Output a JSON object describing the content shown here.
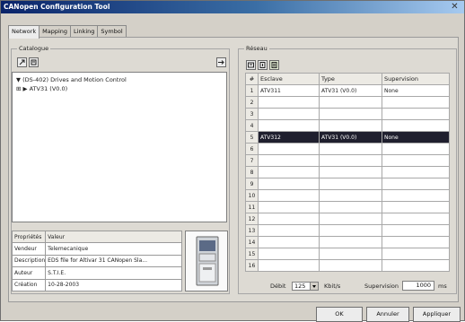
{
  "window": {
    "title": "CANopen Configuration Tool",
    "close_glyph": "✕"
  },
  "tabs": [
    "Network",
    "Mapping",
    "Linking",
    "Symbol"
  ],
  "catalogue": {
    "label": "Catalogue",
    "tree": [
      {
        "expander": "▼",
        "text": "(DS-402) Drives and Motion Control"
      },
      {
        "expander": "⊞  ▶",
        "text": "ATV31 (V0.0)"
      }
    ],
    "properties": {
      "headers": [
        "Propriétés",
        "Valeur"
      ],
      "rows": [
        [
          "Vendeur",
          "Telemecanique"
        ],
        [
          "Description",
          "EDS file for Altivar 31 CANopen Sla..."
        ],
        [
          "Auteur",
          "S.T.I.E."
        ],
        [
          "Création",
          "10-28-2003"
        ]
      ]
    }
  },
  "reseau": {
    "label": "Réseau",
    "columns": [
      "#",
      "Esclave",
      "Type",
      "Supervision"
    ],
    "rows": [
      {
        "num": "1",
        "esclave": "ATV311",
        "type": "ATV31 (V0.0)",
        "supervision": "None"
      },
      {
        "num": "2",
        "esclave": "",
        "type": "",
        "supervision": ""
      },
      {
        "num": "3",
        "esclave": "",
        "type": "",
        "supervision": ""
      },
      {
        "num": "4",
        "esclave": "",
        "type": "",
        "supervision": ""
      },
      {
        "num": "5",
        "esclave": "ATV312",
        "type": "ATV31 (V0.0)",
        "supervision": "None",
        "selected": true
      },
      {
        "num": "6",
        "esclave": "",
        "type": "",
        "supervision": ""
      },
      {
        "num": "7",
        "esclave": "",
        "type": "",
        "supervision": ""
      },
      {
        "num": "8",
        "esclave": "",
        "type": "",
        "supervision": ""
      },
      {
        "num": "9",
        "esclave": "",
        "type": "",
        "supervision": ""
      },
      {
        "num": "10",
        "esclave": "",
        "type": "",
        "supervision": ""
      },
      {
        "num": "11",
        "esclave": "",
        "type": "",
        "supervision": ""
      },
      {
        "num": "12",
        "esclave": "",
        "type": "",
        "supervision": ""
      },
      {
        "num": "13",
        "esclave": "",
        "type": "",
        "supervision": ""
      },
      {
        "num": "14",
        "esclave": "",
        "type": "",
        "supervision": ""
      },
      {
        "num": "15",
        "esclave": "",
        "type": "",
        "supervision": ""
      },
      {
        "num": "16",
        "esclave": "",
        "type": "",
        "supervision": ""
      }
    ],
    "debit_label": "Débit",
    "debit_value": "125",
    "debit_unit": "Kbit/s",
    "supervision_label": "Supervision",
    "supervision_value": "1000",
    "supervision_unit": "ms"
  },
  "buttons": {
    "ok": "OK",
    "cancel": "Annuler",
    "apply": "Appliquer"
  },
  "icons": [
    "catalogue-add-icon",
    "catalogue-open-icon",
    "transfer-arrow-icon",
    "network-add-icon",
    "network-remove-icon",
    "network-properties-icon",
    "drive-product-image"
  ],
  "colors": {
    "title_start": "#0a246a",
    "title_end": "#a6caf0",
    "selection": "#1f1f2e",
    "dialog": "#d4d0c8"
  }
}
